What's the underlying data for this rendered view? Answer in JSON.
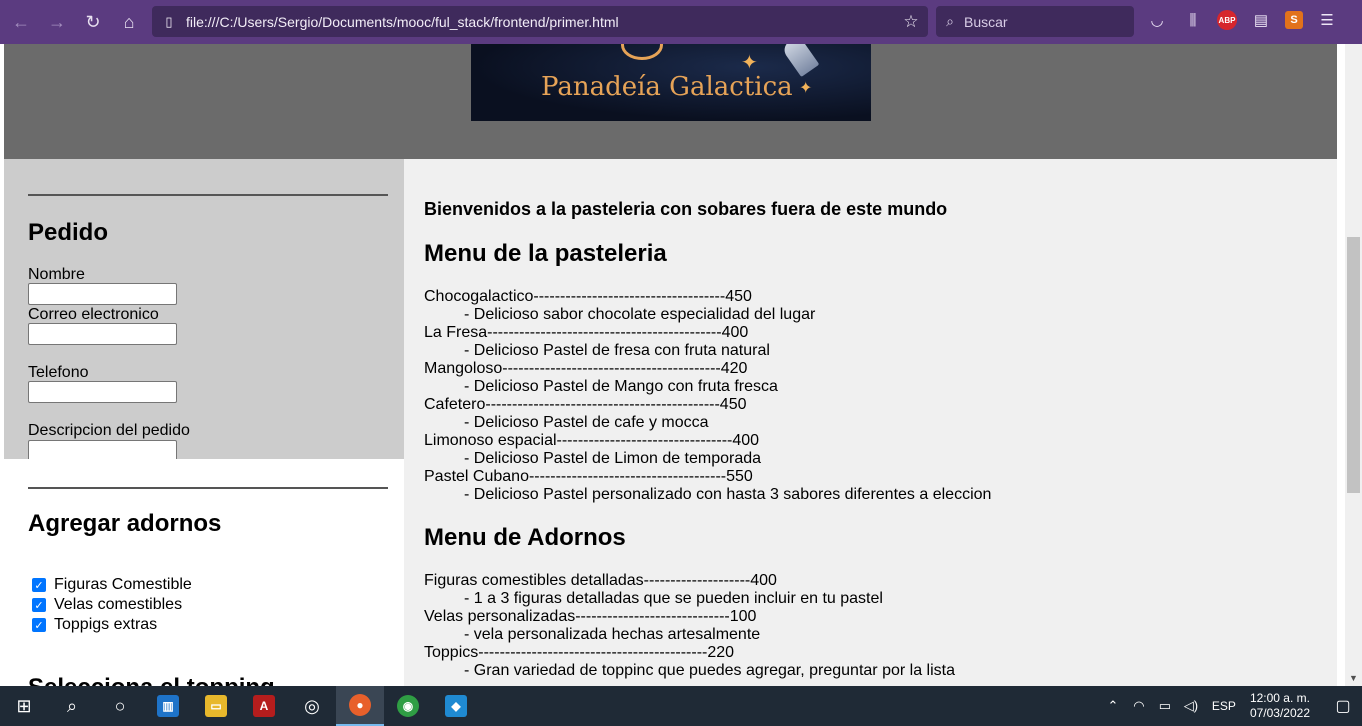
{
  "browser": {
    "url": "file:///C:/Users/Sergio/Documents/mooc/ful_stack/frontend/primer.html",
    "search_placeholder": "Buscar",
    "abp_label": "ABP"
  },
  "header": {
    "logo_text": "Panadeía Galactica"
  },
  "sidebar": {
    "order_title": "Pedido",
    "fields": [
      {
        "label": "Nombre",
        "value": ""
      },
      {
        "label": "Correo electronico",
        "value": ""
      },
      {
        "label": "Telefono",
        "value": ""
      },
      {
        "label": "Descripcion del pedido",
        "value": ""
      }
    ],
    "adornos_title": "Agregar adornos",
    "adornos": [
      {
        "label": "Figuras Comestible",
        "checked": true
      },
      {
        "label": "Velas comestibles",
        "checked": true
      },
      {
        "label": "Toppigs extras",
        "checked": true
      }
    ],
    "topping_title": "Selecciona el topping"
  },
  "main": {
    "welcome": "Bienvenidos a la pasteleria con sobares fuera de este mundo",
    "menu_title": "Menu de la pasteleria",
    "menu_items": [
      {
        "line": "Chocogalactico------------------------------------450",
        "desc": "- Delicioso sabor chocolate especialidad del lugar"
      },
      {
        "line": "La Fresa--------------------------------------------400",
        "desc": "- Delicioso Pastel de fresa con fruta natural"
      },
      {
        "line": "Mangoloso-----------------------------------------420",
        "desc": "- Delicioso Pastel de Mango con fruta fresca"
      },
      {
        "line": "Cafetero--------------------------------------------450",
        "desc": "- Delicioso Pastel de cafe y mocca"
      },
      {
        "line": "Limonoso espacial---------------------------------400",
        "desc": "- Delicioso Pastel de Limon de temporada"
      },
      {
        "line": "Pastel Cubano-------------------------------------550",
        "desc": "- Delicioso Pastel personalizado con hasta 3 sabores diferentes a eleccion"
      }
    ],
    "adornos_menu_title": "Menu de Adornos",
    "adornos_items": [
      {
        "line": "Figuras comestibles detalladas--------------------400",
        "desc": "- 1 a 3 figuras detalladas que se pueden incluir en tu pastel"
      },
      {
        "line": "Velas personalizadas-----------------------------100",
        "desc": "- vela personalizada hechas artesalmente"
      },
      {
        "line": "Toppics-------------------------------------------220",
        "desc": "- Gran variedad de toppinc que puedes agregar, preguntar por la lista"
      }
    ]
  },
  "taskbar": {
    "language": "ESP",
    "time": "12:00 a. m.",
    "date": "07/03/2022"
  }
}
